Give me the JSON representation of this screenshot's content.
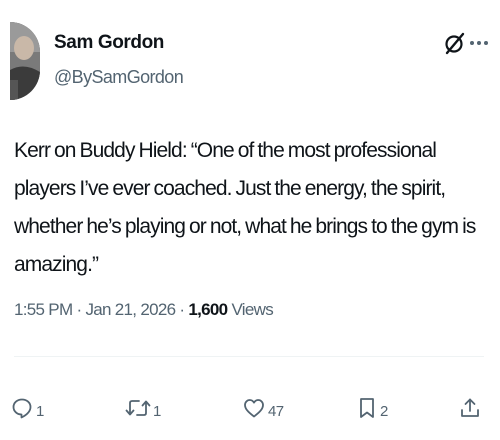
{
  "author": {
    "name": "Sam Gordon",
    "handle": "@BySamGordon"
  },
  "tweet": {
    "text": "Kerr on Buddy Hield: “One of the most professional players I’ve ever coached. Just the energy, the spirit, whether he’s playing or not, what he brings to the gym is amazing.”",
    "time": "1:55 PM",
    "date": "Jan 21, 2026",
    "separator": "·",
    "views_count": "1,600",
    "views_label": "Views"
  },
  "actions": {
    "replies": "1",
    "reposts": "1",
    "likes": "47",
    "bookmarks": "2"
  },
  "icons": {
    "grok": "grok-icon",
    "more": "more-icon",
    "reply": "reply-icon",
    "repost": "repost-icon",
    "like": "heart-icon",
    "bookmark": "bookmark-icon",
    "share": "share-icon"
  },
  "colors": {
    "text": "#0f1419",
    "secondary": "#536471",
    "divider": "#eff3f4"
  }
}
